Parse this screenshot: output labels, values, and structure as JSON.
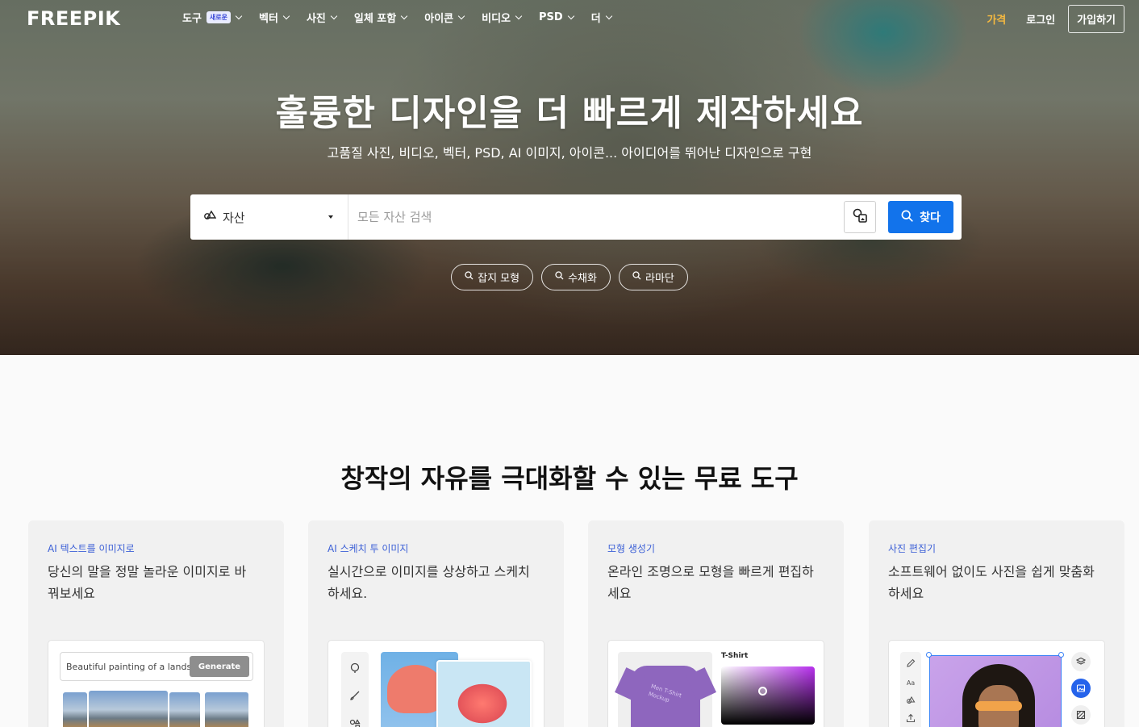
{
  "brand": {
    "logo": "FREEPIK"
  },
  "nav": {
    "items": [
      {
        "label": "도구",
        "badge": "새로운"
      },
      {
        "label": "벡터"
      },
      {
        "label": "사진"
      },
      {
        "label": "일체 포함"
      },
      {
        "label": "아이콘"
      },
      {
        "label": "비디오"
      },
      {
        "label": "PSD"
      },
      {
        "label": "더"
      }
    ],
    "pricing": "가격",
    "login": "로그인",
    "signup": "가입하기"
  },
  "hero": {
    "title": "훌륭한 디자인을 더 빠르게 제작하세요",
    "subtitle": "고품질 사진, 비디오, 벡터, PSD, AI 이미지, 아이콘... 아이디어를 뛰어난 디자인으로 구현"
  },
  "search": {
    "category": "자산",
    "placeholder": "모든 자산 검색",
    "button": "찾다"
  },
  "suggestions": [
    "잡지 모형",
    "수채화",
    "라마단"
  ],
  "tools": {
    "title": "창작의 자유를 극대화할 수 있는 무료 도구",
    "cards": [
      {
        "tag": "AI 텍스트를 이미지로",
        "desc": "당신의 말을 정말 놀라운 이미지로 바꿔보세요",
        "prompt": "Beautiful painting of a landscape",
        "button": "Generate"
      },
      {
        "tag": "AI 스케치 투 이미지",
        "desc": "실시간으로 이미지를 상상하고 스케치하세요."
      },
      {
        "tag": "모형 생성기",
        "desc": "온라인 조명으로 모형을 빠르게 편집하세요",
        "label": "T-Shirt",
        "shirt_text": "Men T-Shirt Mockup"
      },
      {
        "tag": "사진 편집기",
        "desc": "소프트웨어 없이도 사진을 쉽게 맞춤화하세요"
      }
    ]
  },
  "colors": {
    "accent": "#1273eb",
    "pricing": "#f5b940",
    "tag": "#3b5fd6"
  }
}
